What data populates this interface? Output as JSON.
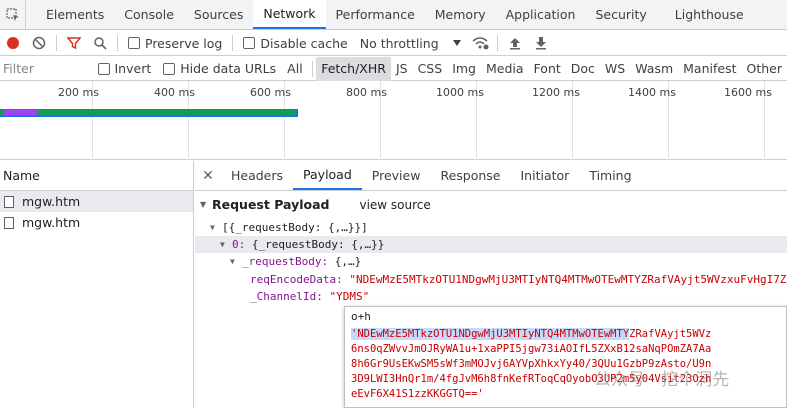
{
  "tabs": [
    "Elements",
    "Console",
    "Sources",
    "Network",
    "Performance",
    "Memory",
    "Application",
    "Security",
    "Lighthouse"
  ],
  "active_tab": "Network",
  "toolbar": {
    "preserve_log": "Preserve log",
    "disable_cache": "Disable cache",
    "throttling": "No throttling"
  },
  "filter": {
    "placeholder": "Filter",
    "invert": "Invert",
    "hide_data_urls": "Hide data URLs",
    "types": [
      "All",
      "Fetch/XHR",
      "JS",
      "CSS",
      "Img",
      "Media",
      "Font",
      "Doc",
      "WS",
      "Wasm",
      "Manifest",
      "Other"
    ],
    "selected_type": "Fetch/XHR"
  },
  "timeline": {
    "ticks": [
      "200 ms",
      "400 ms",
      "600 ms",
      "800 ms",
      "1000 ms",
      "1200 ms",
      "1400 ms",
      "1600 ms"
    ]
  },
  "requests": {
    "header": "Name",
    "rows": [
      "mgw.htm",
      "mgw.htm"
    ]
  },
  "details": {
    "tabs": [
      "Headers",
      "Payload",
      "Preview",
      "Response",
      "Initiator",
      "Timing"
    ],
    "active_tab": "Payload",
    "section_title": "Request Payload",
    "view_source": "view source",
    "tree": {
      "root": "[{_requestBody: {,…}}]",
      "item0_key": "0",
      "item0_value": "{_requestBody: {,…}}",
      "request_body_key": "_requestBody",
      "request_body_value": "{,…}",
      "req_encode_key": "reqEncodeData",
      "req_encode_value": "\"NDEwMzE5MTkzOTU1NDgwMjU3MTIyNTQ4MTMwOTEwMTYZRafVAyjt5WVzxuFvHgI7Z",
      "channel_key": "_ChannelId",
      "channel_value": "\"YDMS\""
    }
  },
  "popover": {
    "header": "o+h",
    "line1_selected": "'NDEwMzE5MTkzOTU1NDgwMjU3MTIyNTQ4MTMwOTEwMTY",
    "line1_rest": "ZRafVAyjt5WVz",
    "lines": [
      "6ns0qZWvvJmOJRyWA1u+1xaPPI5jgw73iAOIfL5ZXxB12saNqPOmZA7Aa",
      "8h6Gr9UsEKwSM5sWf3mMOJvj6AYVpXhkxYy40/3QUu1GzbP9zAsto/U9n",
      "3D9LWI3HnQr1m/4fgJvM6h8fnKefRToqCqOyobO3UP2m5y04Vsit23Ozh",
      "eEvF6X41S1zzKKGGTQ=='"
    ]
  },
  "watermark": "公众号 · 挖个洞先"
}
